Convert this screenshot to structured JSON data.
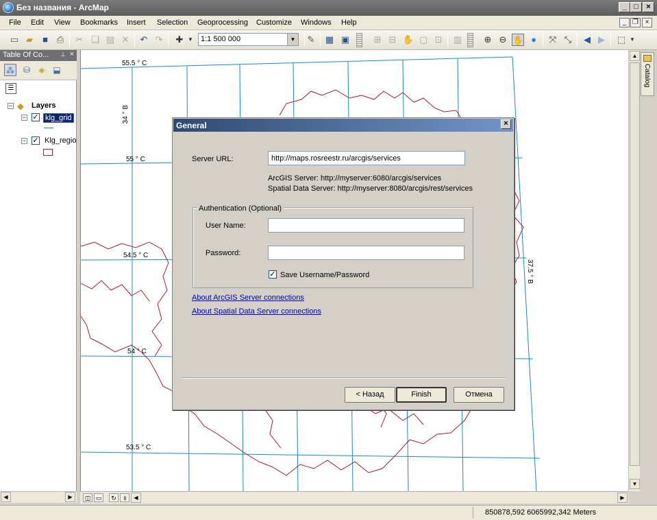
{
  "window": {
    "title": "Без названия - ArcMap"
  },
  "menu": [
    "File",
    "Edit",
    "View",
    "Bookmarks",
    "Insert",
    "Selection",
    "Geoprocessing",
    "Customize",
    "Windows",
    "Help"
  ],
  "toolbar": {
    "scale": "1:1 500 000"
  },
  "toc": {
    "title": "Table Of Co...",
    "root": "Layers",
    "layers": [
      "klg_grid",
      "Klg_regio"
    ]
  },
  "map": {
    "lat_labels": [
      "55.5 ° C",
      "55 ° C",
      "54.5 ° C",
      "54 ° C",
      "53.5 ° C"
    ],
    "lon_labels": [
      "34 ° B",
      "37.5 ° B"
    ]
  },
  "catalog": {
    "label": "Catalog"
  },
  "status": {
    "coords": "850878,592  6065992,342 Meters"
  },
  "dialog": {
    "title": "General",
    "server_url_label": "Server URL:",
    "server_url_value": "http://maps.rosreestr.ru/arcgis/services",
    "hint_arcgis": "ArcGIS Server: http://myserver:6080/arcgis/services",
    "hint_spatial": "Spatial Data Server: http://myserver:8080/arcgis/rest/services",
    "auth_group": "Authentication (Optional)",
    "username_label": "User Name:",
    "username_value": "",
    "password_label": "Password:",
    "password_value": "",
    "save_label": "Save Username/Password",
    "link_arcgis": "About ArcGIS Server connections",
    "link_spatial": "About Spatial Data Server connections",
    "back_label": "< Назад",
    "finish_label": "Finish",
    "cancel_label": "Отмена"
  }
}
